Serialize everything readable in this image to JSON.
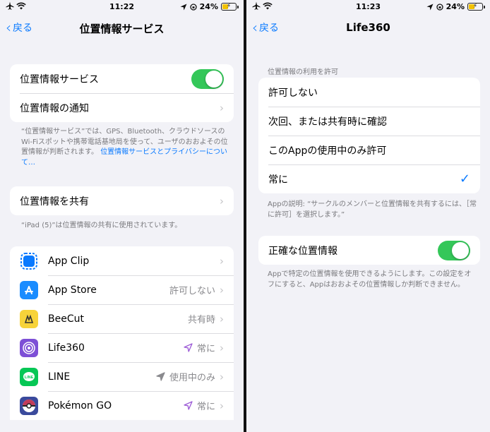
{
  "left": {
    "status": {
      "time": "11:22",
      "battery": "24%"
    },
    "back_label": "戻る",
    "title": "位置情報サービス",
    "main_group": {
      "location_services_label": "位置情報サービス",
      "location_services_on": true,
      "notification_label": "位置情報の通知"
    },
    "footer1_text": "“位置情報サービス”では、GPS、Bluetooth、クラウドソースのWi-Fiスポットや携帯電話基地局を使って、ユーザのおおよその位置情報が判断されます。",
    "footer1_link": "位置情報サービスとプライバシーについて…",
    "share_label": "位置情報を共有",
    "footer2_text": "“iPad (5)”は位置情報の共有に使用されています。",
    "apps": [
      {
        "name": "App Clip",
        "value": "",
        "arrow": "",
        "icon": "app-clip-icon",
        "color": "#0a7aff"
      },
      {
        "name": "App Store",
        "value": "許可しない",
        "arrow": "",
        "icon": "app-store-icon",
        "color": "#1a8cff"
      },
      {
        "name": "BeeCut",
        "value": "共有時",
        "arrow": "",
        "icon": "beecut-icon",
        "color": "#f7d33a"
      },
      {
        "name": "Life360",
        "value": "常に",
        "arrow": "purple",
        "icon": "life360-icon",
        "color": "#7d4fd6"
      },
      {
        "name": "LINE",
        "value": "使用中のみ",
        "arrow": "gray",
        "icon": "line-icon",
        "color": "#06c755"
      },
      {
        "name": "Pokémon GO",
        "value": "常に",
        "arrow": "purple",
        "icon": "pokemon-go-icon",
        "color": "#c23b5a"
      }
    ]
  },
  "right": {
    "status": {
      "time": "11:23",
      "battery": "24%"
    },
    "back_label": "戻る",
    "title": "Life360",
    "section_header": "位置情報の利用を許可",
    "options": [
      {
        "label": "許可しない",
        "selected": false
      },
      {
        "label": "次回、または共有時に確認",
        "selected": false
      },
      {
        "label": "このAppの使用中のみ許可",
        "selected": false
      },
      {
        "label": "常に",
        "selected": true
      }
    ],
    "check_glyph": "✓",
    "explanation": "Appの説明: “サークルのメンバーと位置情報を共有するには、［常に許可］を選択します。”",
    "precise_label": "正確な位置情報",
    "precise_on": true,
    "precise_footer": "Appで特定の位置情報を使用できるようにします。この設定をオフにすると、Appはおおよその位置情報しか判断できません。"
  }
}
